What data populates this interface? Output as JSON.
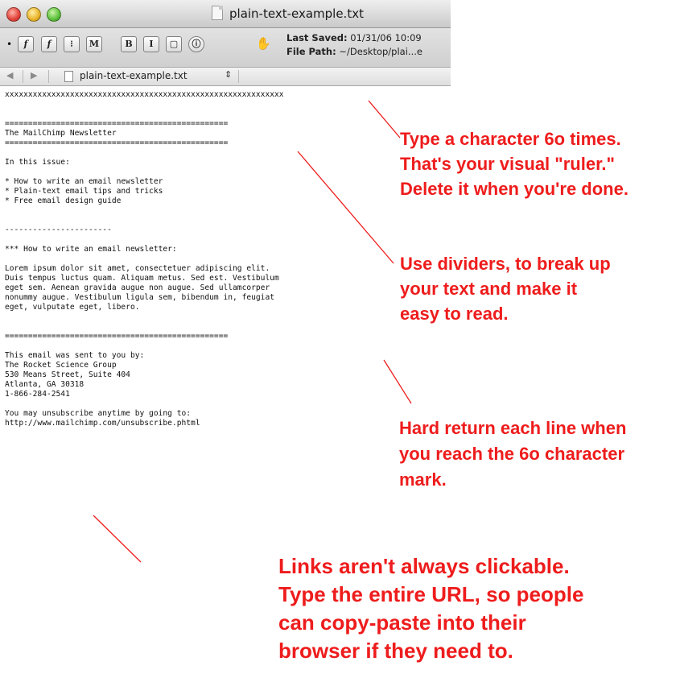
{
  "window": {
    "title": "plain-text-example.txt",
    "last_saved_label": "Last Saved:",
    "last_saved_value": "01/31/06 10:09",
    "file_path_label": "File Path:",
    "file_path_value": "~/Desktop/plai...e"
  },
  "toolbar": {
    "bullet": "•",
    "buttons": [
      "𝒇",
      "f",
      "⁝",
      "M",
      "B",
      "I",
      "▢",
      "ⓘ"
    ]
  },
  "navbar": {
    "back": "◀",
    "forward": "▶",
    "file": "plain-text-example.txt",
    "updown": "⇕"
  },
  "document": {
    "lines": [
      "xxxxxxxxxxxxxxxxxxxxxxxxxxxxxxxxxxxxxxxxxxxxxxxxxxxxxxxxxxxx",
      "",
      "",
      "================================================",
      "The MailChimp Newsletter",
      "================================================",
      "",
      "In this issue:",
      "",
      "* How to write an email newsletter",
      "* Plain-text email tips and tricks",
      "* Free email design guide",
      "",
      "",
      "-----------------------",
      "",
      "*** How to write an email newsletter:",
      "",
      "Lorem ipsum dolor sit amet, consectetuer adipiscing elit.",
      "Duis tempus luctus quam. Aliquam metus. Sed est. Vestibulum",
      "eget sem. Aenean gravida augue non augue. Sed ullamcorper",
      "nonummy augue. Vestibulum ligula sem, bibendum in, feugiat",
      "eget, vulputate eget, libero.",
      "",
      "",
      "================================================",
      "",
      "This email was sent to you by:",
      "The Rocket Science Group",
      "530 Means Street, Suite 404",
      "Atlanta, GA 30318",
      "1-866-284-2541",
      "",
      "You may unsubscribe anytime by going to:",
      "http://www.mailchimp.com/unsubscribe.phtml"
    ]
  },
  "annotations": {
    "ruler": [
      "Type a character 6o times.",
      "That's your visual \"ruler.\"",
      "Delete it when you're done."
    ],
    "dividers": [
      "Use dividers, to break up",
      "your text and make it",
      "easy to read."
    ],
    "hard_return": [
      "Hard return each line when",
      "you reach the 6o character",
      "mark."
    ],
    "links": [
      "Links aren't always clickable.",
      "Type the entire URL, so people",
      "can copy-paste into their",
      "browser if they need to."
    ]
  },
  "colors": {
    "annotation": "#ee1c1c"
  }
}
